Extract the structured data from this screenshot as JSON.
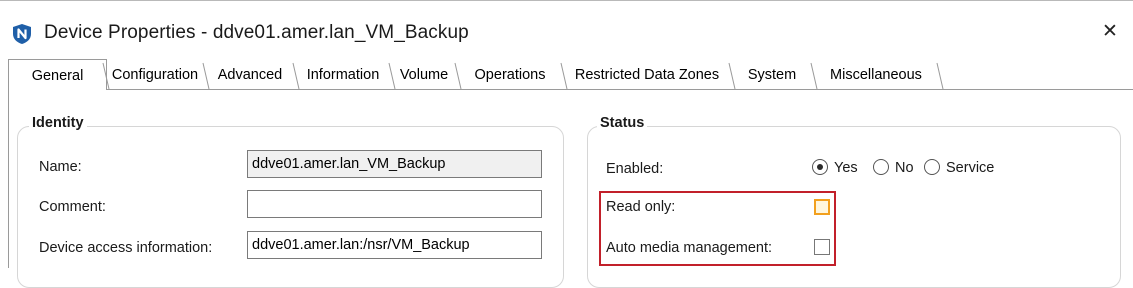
{
  "window": {
    "title": "Device Properties - ddve01.amer.lan_VM_Backup",
    "app_icon": "shield-icon",
    "close_icon": "close-icon",
    "close_glyph": "✕"
  },
  "tabs": [
    {
      "label": "General",
      "active": true
    },
    {
      "label": "Configuration",
      "active": false
    },
    {
      "label": "Advanced",
      "active": false
    },
    {
      "label": "Information",
      "active": false
    },
    {
      "label": "Volume",
      "active": false
    },
    {
      "label": "Operations",
      "active": false
    },
    {
      "label": "Restricted Data Zones",
      "active": false
    },
    {
      "label": "System",
      "active": false
    },
    {
      "label": "Miscellaneous",
      "active": false
    }
  ],
  "identity": {
    "title": "Identity",
    "name_label": "Name:",
    "name_value": "ddve01.amer.lan_VM_Backup",
    "comment_label": "Comment:",
    "comment_value": "",
    "access_label": "Device access information:",
    "access_value": "ddve01.amer.lan:/nsr/VM_Backup"
  },
  "status": {
    "title": "Status",
    "enabled_label": "Enabled:",
    "enabled_options": [
      {
        "label": "Yes",
        "selected": true
      },
      {
        "label": "No",
        "selected": false
      },
      {
        "label": "Service",
        "selected": false
      }
    ],
    "read_only_label": "Read only:",
    "read_only_checked": false,
    "auto_media_label": "Auto media management:",
    "auto_media_checked": false
  },
  "colors": {
    "highlight": "#c2202a",
    "focus": "#f2a01e",
    "app_icon": "#1f5fa8"
  }
}
